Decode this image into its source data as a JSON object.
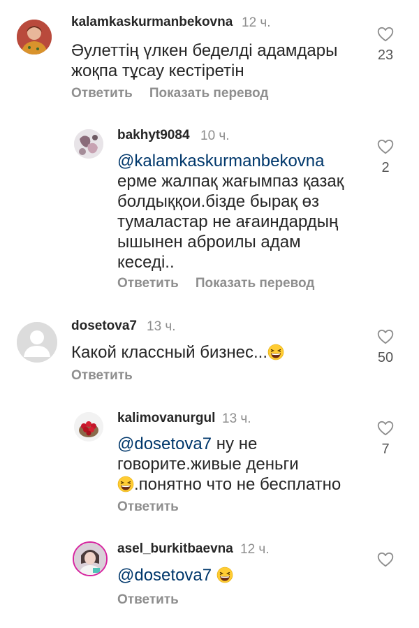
{
  "actions": {
    "reply": "Ответить",
    "translate": "Показать перевод"
  },
  "comments": [
    {
      "username": "kalamkaskurmanbekovna",
      "time": "12 ч.",
      "lines": [
        "Әулеттің үлкен  беделді  адамдары",
        "жоқпа тұсау кестіретін"
      ],
      "likes": "23"
    },
    {
      "username": "bakhyt9084",
      "time": "10 ч.",
      "mention": "@kalamkaskurmanbekovna",
      "lines": [
        "ерме жалпақ жағымпаз қазақ",
        "болдыққои.бізде бырақ өз",
        "тумаластар не ағаиндардың",
        "ышынен аброилы адам",
        "кеседі.."
      ],
      "likes": "2"
    },
    {
      "username": "dosetova7",
      "time": "13 ч.",
      "lines": [
        "Какой классный бизнес..."
      ],
      "likes": "50"
    },
    {
      "username": "kalimovanurgul",
      "time": "13 ч.",
      "mention": "@dosetova7",
      "line1_rest": " ну не",
      "lines": [
        "говорите.живые деньги",
        ".понятно что не бесплатно"
      ],
      "likes": "7"
    },
    {
      "username": "asel_burkitbaevna",
      "time": "12 ч.",
      "mention": "@dosetova7"
    }
  ],
  "colors": {
    "text": "#262626",
    "muted": "#8e8e8e",
    "mention": "#00376b",
    "background": "#ffffff"
  }
}
